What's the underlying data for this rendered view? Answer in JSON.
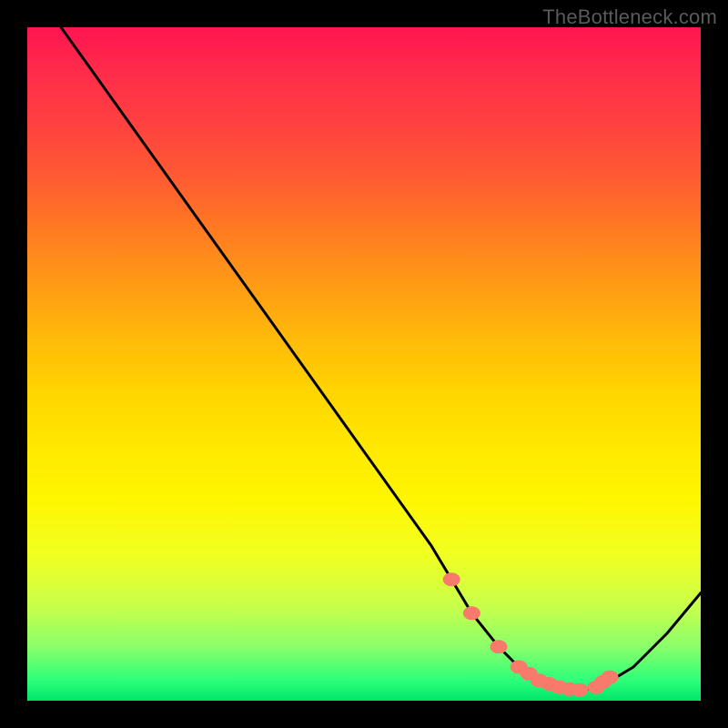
{
  "watermark": "TheBottleneck.com",
  "chart_data": {
    "type": "line",
    "title": "",
    "xlabel": "",
    "ylabel": "",
    "xlim": [
      0,
      100
    ],
    "ylim": [
      0,
      100
    ],
    "grid": false,
    "series": [
      {
        "name": "curve",
        "x": [
          5,
          10,
          15,
          20,
          25,
          30,
          35,
          40,
          45,
          50,
          55,
          60,
          63,
          66,
          70,
          73,
          76,
          78,
          80,
          82,
          85,
          90,
          95,
          100
        ],
        "y": [
          100,
          93,
          86,
          79,
          72,
          65,
          58,
          51,
          44,
          37,
          30,
          23,
          18,
          13,
          8,
          5,
          3,
          2,
          1.5,
          1.5,
          2,
          5,
          10,
          16
        ]
      }
    ],
    "markers": {
      "name": "dots",
      "x": [
        63,
        66,
        70,
        73,
        74.5,
        76,
        77.5,
        79,
        80.5,
        82,
        84.5,
        85.5,
        86.5
      ],
      "y": [
        18,
        13,
        8,
        5,
        4,
        3,
        2.5,
        2,
        1.7,
        1.6,
        2,
        2.8,
        3.5
      ]
    }
  }
}
